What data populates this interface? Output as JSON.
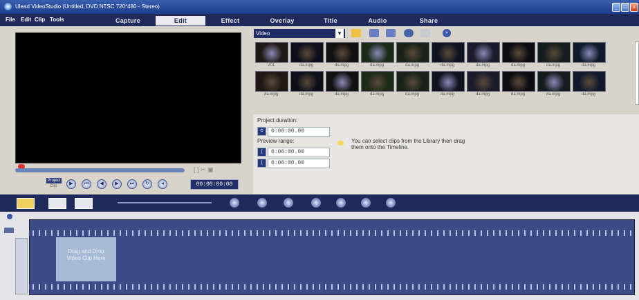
{
  "window": {
    "title": "Ulead VideoStudio (Untitled, DVD NTSC 720*480 - Stereo)"
  },
  "menu": {
    "items": [
      "File",
      "Edit",
      "Clip",
      "Tools"
    ]
  },
  "steps": [
    "Capture",
    "Edit",
    "Effect",
    "Overlay",
    "Title",
    "Audio",
    "Share"
  ],
  "active_step": "Edit",
  "player": {
    "mode_project": "Project",
    "mode_clip": "Clip",
    "timecode": "00:00:00:00"
  },
  "library": {
    "category": "Video",
    "thumbs": [
      "V01",
      "da.mpg",
      "da.mpg",
      "da.mpg",
      "da.mpg",
      "da.mpg",
      "da.mpg",
      "da.mpg",
      "da.mpg",
      "da.mpg",
      "da.mpg",
      "da.mpg",
      "da.mpg",
      "da.mpg",
      "da.mpg",
      "da.mpg",
      "da.mpg",
      "da.mpg",
      "da.mpg",
      "da.mpg"
    ]
  },
  "options": {
    "project_duration_label": "Project duration:",
    "project_duration_value": "0:00:00.00",
    "preview_range_label": "Preview range:",
    "preview_start": "0:00:00.00",
    "preview_end": "0:00:00.00",
    "hint": "You can select clips from the Library then drag them onto the Timeline."
  },
  "timeline": {
    "drop_hint": "Drag and Drop Video Clip Here"
  },
  "colors": {
    "titlebar": "#1b3c8c",
    "stepbar": "#1f2a5a",
    "track": "#3c4a86"
  }
}
